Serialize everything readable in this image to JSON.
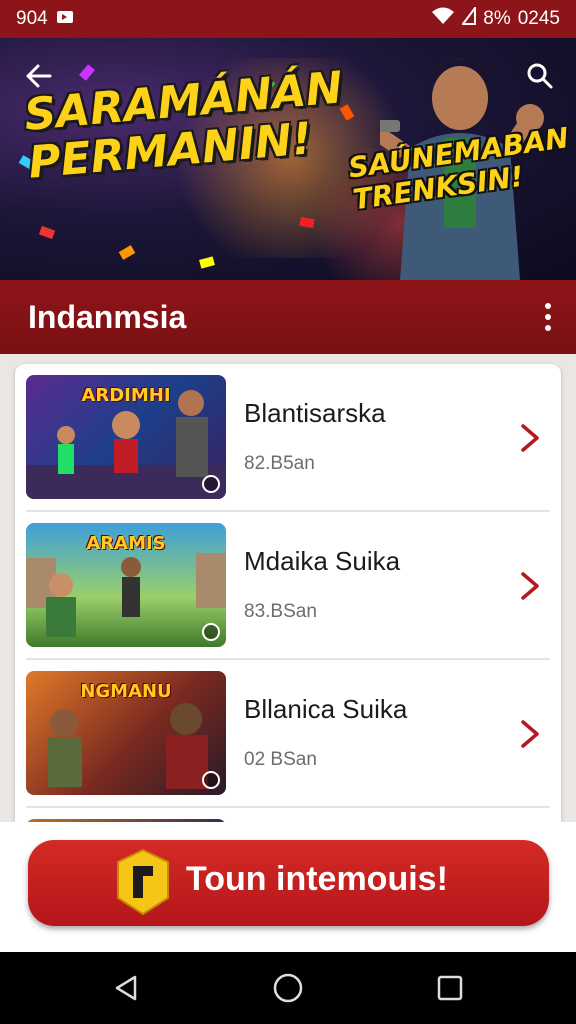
{
  "status_bar": {
    "left_text": "904",
    "battery": "8%",
    "time": "0245"
  },
  "banner": {
    "title_line1": "SARAMÁNÁN",
    "title_line2": "PERMANIN!",
    "subtitle_line1": "SAÚNEMABAN",
    "subtitle_line2": "TRENKSIN!"
  },
  "header": {
    "title": "Indanmsia"
  },
  "list": {
    "items": [
      {
        "name": "Blantisarska",
        "meta": "82.B5an",
        "thumb_label": "ARDIMHI"
      },
      {
        "name": "Mdaika Suika",
        "meta": "83.BSan",
        "thumb_label": "ARAMIS"
      },
      {
        "name": "Bllanica Suika",
        "meta": "02 BSan",
        "thumb_label": "NGMANU"
      }
    ]
  },
  "cta": {
    "label": "Toun intemouis!"
  },
  "colors": {
    "brand_red": "#8d1418",
    "accent_yellow": "#ffd21a",
    "cta_red": "#c8201f"
  }
}
